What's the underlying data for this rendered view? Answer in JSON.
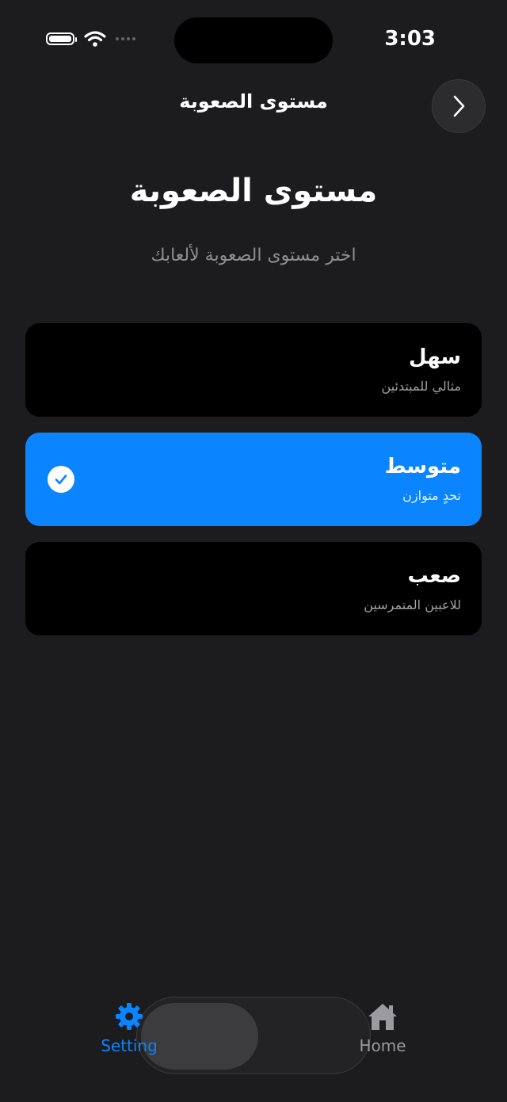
{
  "status": {
    "time": "3:03"
  },
  "nav": {
    "title": "مستوى الصعوبة",
    "forward_icon": "chevron-right-icon"
  },
  "header": {
    "title": "مستوى الصعوبة",
    "subtitle": "اختر مستوى الصعوبة لألعابك"
  },
  "options": [
    {
      "title": "سهل",
      "description": "مثالي للمبتدئين",
      "selected": false
    },
    {
      "title": "متوسط",
      "description": "تحدٍ متوازن",
      "selected": true
    },
    {
      "title": "صعب",
      "description": "للاعبين المتمرسين",
      "selected": false
    }
  ],
  "tabs": [
    {
      "label": "Setting",
      "icon": "gear-icon",
      "active": true
    },
    {
      "label": "Home",
      "icon": "house-icon",
      "active": false
    }
  ],
  "colors": {
    "accent": "#0a84ff",
    "background": "#1c1c1e",
    "card": "#000000"
  }
}
